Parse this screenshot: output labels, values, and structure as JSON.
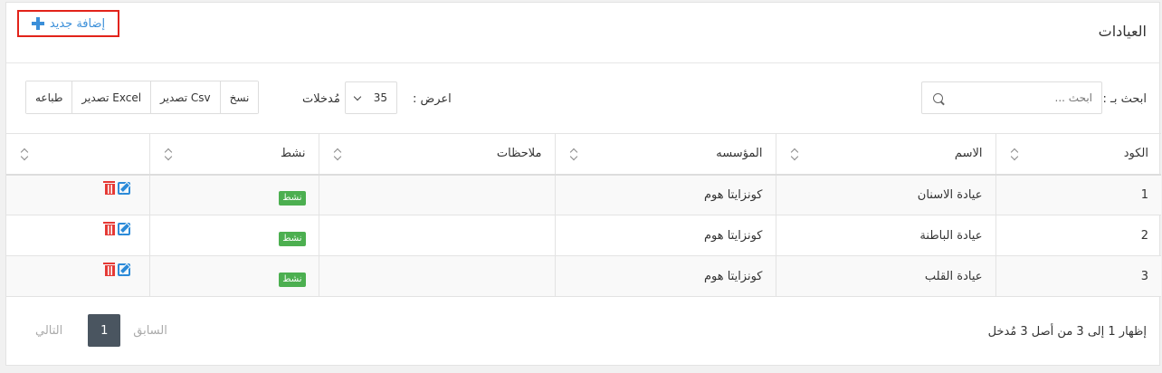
{
  "header": {
    "title": "العيادات",
    "add_label": "إضافة جديد"
  },
  "toolbar": {
    "search_label": "ابحث بـ :",
    "search_placeholder": "ابحث ...",
    "show_label": "اعرض :",
    "entries_value": "35",
    "entries_label": "مُدخلات",
    "buttons": [
      "طباعه",
      "تصدير Excel",
      "تصدير Csv",
      "نسخ"
    ]
  },
  "table": {
    "columns": [
      "الكود",
      "الاسم",
      "المؤسسه",
      "ملاحظات",
      "نشط",
      ""
    ],
    "rows": [
      {
        "code": "1",
        "name": "عيادة الاسنان",
        "org": "كونزايتا هوم",
        "notes": "",
        "status": "نشط"
      },
      {
        "code": "2",
        "name": "عيادة الباطنة",
        "org": "كونزايتا هوم",
        "notes": "",
        "status": "نشط"
      },
      {
        "code": "3",
        "name": "عيادة القلب",
        "org": "كونزايتا هوم",
        "notes": "",
        "status": "نشط"
      }
    ]
  },
  "footer": {
    "info": "إظهار 1 إلى 3 من أصل 3 مُدخل",
    "next": "التالي",
    "page": "1",
    "prev": "السابق"
  },
  "colors": {
    "accent": "#3b8fd9",
    "danger": "#e53935",
    "success": "#4caf50",
    "highlight_border": "#e2231a"
  }
}
